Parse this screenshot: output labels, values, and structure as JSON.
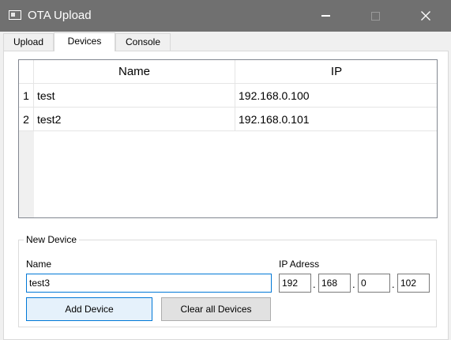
{
  "window": {
    "title": "OTA Upload",
    "icons": {
      "app": "app-window-icon",
      "minimize": "minimize-icon",
      "maximize": "maximize-icon",
      "close": "close-icon"
    },
    "close_glyph": "✕"
  },
  "tabs": [
    {
      "label": "Upload",
      "active": false
    },
    {
      "label": "Devices",
      "active": true
    },
    {
      "label": "Console",
      "active": false
    }
  ],
  "devices_table": {
    "columns": [
      "Name",
      "IP"
    ],
    "rows": [
      {
        "index": "1",
        "name": "test",
        "ip": "192.168.0.100"
      },
      {
        "index": "2",
        "name": "test2",
        "ip": "192.168.0.101"
      }
    ]
  },
  "new_device": {
    "group_title": "New Device",
    "name_label": "Name",
    "name_value": "test3",
    "ip_label": "IP Adress",
    "ip_octets": [
      "192",
      "168",
      "0",
      "102"
    ],
    "separator": ".",
    "add_button": "Add Device",
    "clear_button": "Clear all Devices"
  },
  "colors": {
    "titlebar": "#707070",
    "accent": "#0078d7",
    "add_button_bg": "#e5f1fb"
  }
}
